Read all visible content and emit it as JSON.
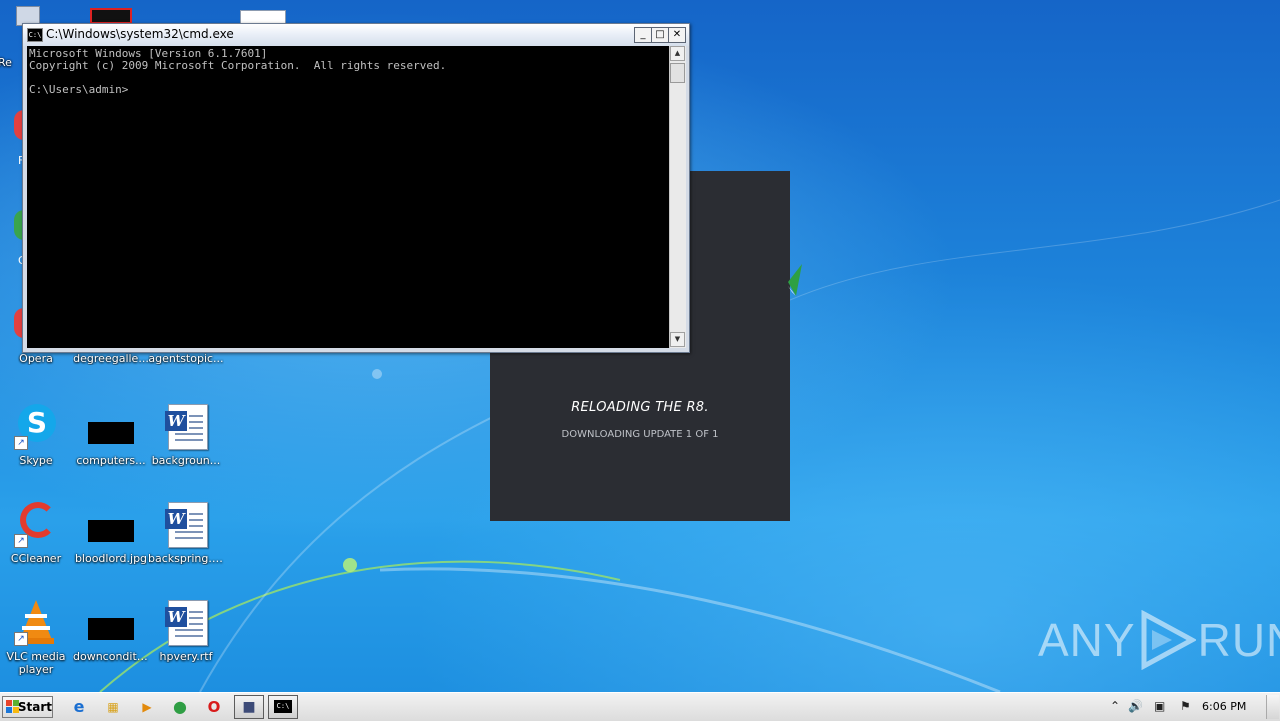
{
  "desktop": {
    "icons": [
      {
        "label": "Opera",
        "type": "opera"
      },
      {
        "label": "degreegalle...",
        "type": "blank"
      },
      {
        "label": "agentstopic...",
        "type": "blank"
      },
      {
        "label": "Skype",
        "type": "skype"
      },
      {
        "label": "computers...",
        "type": "black-image"
      },
      {
        "label": "backgroun...",
        "type": "word-doc"
      },
      {
        "label": "CCleaner",
        "type": "ccleaner"
      },
      {
        "label": "bloodlord.jpg",
        "type": "black-image"
      },
      {
        "label": "backspring.rtf",
        "type": "word-doc"
      },
      {
        "label": "VLC media player",
        "type": "vlc"
      },
      {
        "label": "downconditi...",
        "type": "black-image"
      },
      {
        "label": "hpvery.rtf",
        "type": "word-doc"
      }
    ],
    "partial_labels": [
      "Re",
      "F",
      "G"
    ]
  },
  "installer": {
    "title": "RELOADING THE R8.",
    "subtitle": "DOWNLOADING UPDATE 1 OF 1",
    "background": "#2b2d33"
  },
  "cmd": {
    "title": "C:\\Windows\\system32\\cmd.exe",
    "lines": [
      "Microsoft Windows [Version 6.1.7601]",
      "Copyright (c) 2009 Microsoft Corporation.  All rights reserved.",
      "",
      "C:\\Users\\admin>"
    ],
    "buttons": {
      "minimize": "_",
      "maximize": "□",
      "close": "✕"
    },
    "scroll_up": "▲",
    "scroll_down": "▼"
  },
  "watermark": {
    "left": "ANY",
    "right": "RUN"
  },
  "taskbar": {
    "start_label": "Start",
    "pinned": [
      {
        "name": "internet-explorer-icon",
        "glyph": "e",
        "color": "#1b6fd1"
      },
      {
        "name": "windows-explorer-icon",
        "glyph": "▦",
        "color": "#d8a21c"
      },
      {
        "name": "media-player-icon",
        "glyph": "▶",
        "color": "#e28a0c"
      },
      {
        "name": "chrome-icon",
        "glyph": "●",
        "color": "#2f9e44"
      },
      {
        "name": "opera-icon",
        "glyph": "O",
        "color": "#d81b1b"
      }
    ],
    "tasks": [
      {
        "name": "installer-task-icon",
        "glyph": "■"
      },
      {
        "name": "cmd-task-icon",
        "glyph": "C:\\"
      }
    ],
    "tray": {
      "chevron": "⌃",
      "volume": "🔊",
      "network": "▣",
      "flag": "⚑"
    },
    "clock": "6:06 PM"
  }
}
